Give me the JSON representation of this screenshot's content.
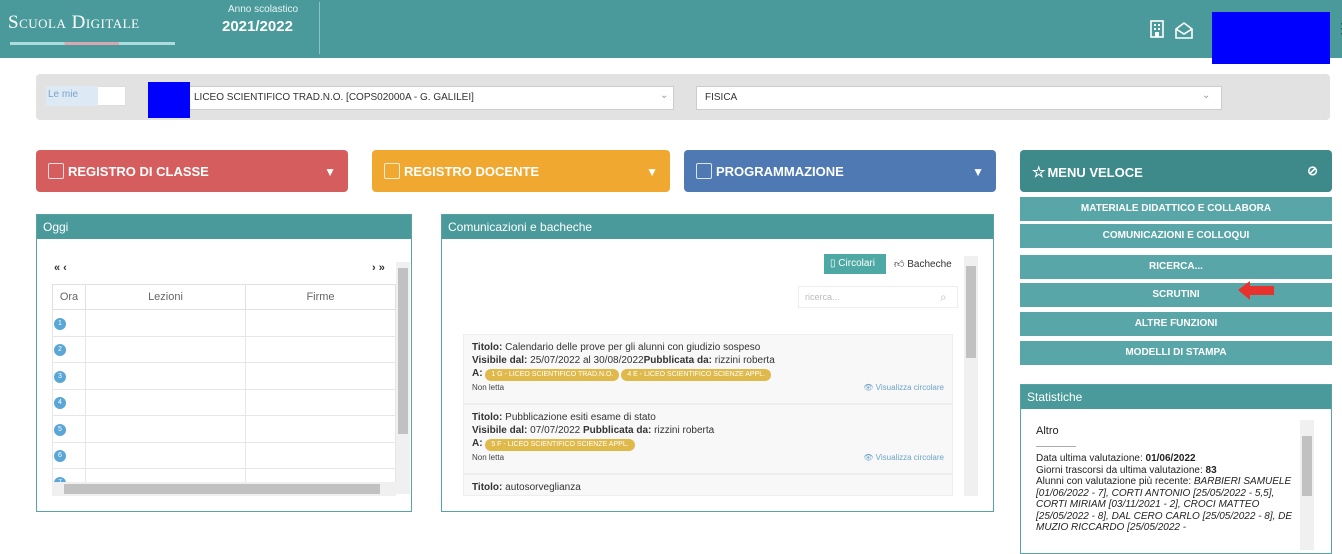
{
  "header": {
    "logo": "Scuola Digitale",
    "year_label": "Anno scolastico",
    "year_value": "2021/2022"
  },
  "selectors": {
    "class_select": "Le mie",
    "school": "LICEO SCIENTIFICO TRAD.N.O. [COPS02000A - G. GALILEI]",
    "subject": "FISICA"
  },
  "menu": {
    "registro_classe": "REGISTRO DI CLASSE",
    "registro_docente": "REGISTRO DOCENTE",
    "programmazione": "PROGRAMMAZIONE",
    "menu_veloce": "MENU VELOCE"
  },
  "quick_menu": [
    "MATERIALE DIDATTICO E COLLABORA",
    "COMUNICAZIONI E COLLOQUI",
    "RICERCA...",
    "SCRUTINI",
    "ALTRE FUNZIONI",
    "MODELLI DI STAMPA"
  ],
  "oggi": {
    "title": "Oggi",
    "nav_prev": "« ‹",
    "nav_next": "› »",
    "columns": [
      "Ora",
      "Lezioni",
      "Firme"
    ],
    "hours": [
      "1",
      "2",
      "3",
      "4",
      "5",
      "6",
      "7"
    ]
  },
  "comunicazioni": {
    "title": "Comunicazioni e bacheche",
    "tab_circolari": "Circolari",
    "tab_bacheche": "Bacheche",
    "search_placeholder": "ricerca...",
    "items": [
      {
        "titolo_label": "Titolo:",
        "titolo": "Calendario delle prove per gli alunni con giudizio sospeso",
        "visibile_label": "Visibile dal:",
        "visibile": "25/07/2022 al 30/08/2022",
        "pubblicata_label": "Pubblicata da:",
        "pubblicata": "rizzini roberta",
        "a_label": "A:",
        "tag1": "1 G - LICEO SCIENTIFICO TRAD.N.O.",
        "tag2": "4 E - LICEO SCIENTIFICO SCIENZE APPL.",
        "status": "Non letta",
        "link": "Visualizza circolare"
      },
      {
        "titolo_label": "Titolo:",
        "titolo": "Pubblicazione esiti esame di stato",
        "visibile_label": "Visibile dal:",
        "visibile": "07/07/2022",
        "pubblicata_label": "Pubblicata da:",
        "pubblicata": "rizzini roberta",
        "a_label": "A:",
        "tag1": "5 F - LICEO SCIENTIFICO SCIENZE APPL.",
        "status": "Non letta",
        "link": "Visualizza circolare"
      },
      {
        "titolo_label": "Titolo:",
        "titolo": "autosorveglianza"
      }
    ]
  },
  "statistiche": {
    "title": "Statistiche",
    "section": "Altro",
    "divider": "--------------------",
    "line1_label": "Data ultima valutazione:",
    "line1_value": "01/06/2022",
    "line2_label": "Giorni trascorsi da ultima valutazione:",
    "line2_value": "83",
    "line3": "Alunni con valutazione più recente:",
    "line4": "BARBIERI SAMUELE [01/06/2022 - 7], CORTI ANTONIO [25/05/2022 - 5,5], CORTI MIRIAM [03/11/2021 - 2], CROCI MATTEO [25/05/2022 - 8], DAL CERO CARLO [25/05/2022 - 8], DE MUZIO RICCARDO [25/05/2022 -"
  }
}
